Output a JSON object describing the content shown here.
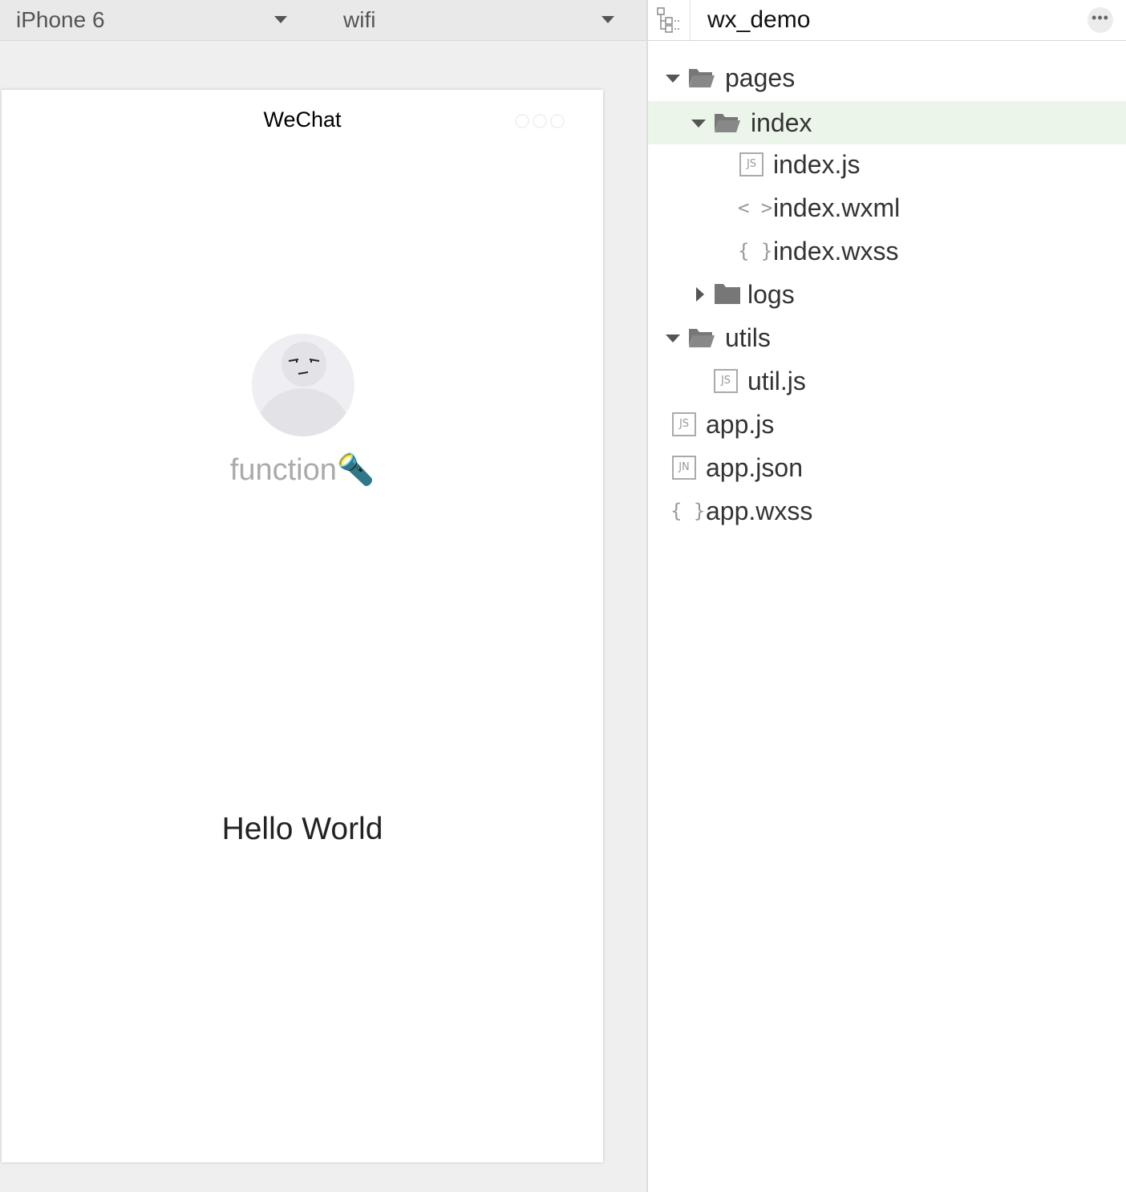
{
  "simulator": {
    "device": "iPhone 6",
    "network": "wifi",
    "nav_title": "WeChat",
    "nickname": "function🔦",
    "body_text": "Hello World"
  },
  "explorer": {
    "project_name": "wx_demo",
    "tree": [
      {
        "label": "pages",
        "type": "folder",
        "state": "open"
      },
      {
        "label": "index",
        "type": "folder",
        "state": "open",
        "selected": true
      },
      {
        "label": "index.js",
        "type": "file",
        "icon": "js-file-icon",
        "badge": "JS"
      },
      {
        "label": "index.wxml",
        "type": "file",
        "icon": "wxml-file-icon",
        "badge": "< >"
      },
      {
        "label": "index.wxss",
        "type": "file",
        "icon": "wxss-file-icon",
        "badge": "{ }"
      },
      {
        "label": "logs",
        "type": "folder",
        "state": "closed"
      },
      {
        "label": "utils",
        "type": "folder",
        "state": "open"
      },
      {
        "label": "util.js",
        "type": "file",
        "icon": "js-file-icon",
        "badge": "JS"
      },
      {
        "label": "app.js",
        "type": "file",
        "icon": "js-file-icon",
        "badge": "JS"
      },
      {
        "label": "app.json",
        "type": "file",
        "icon": "json-file-icon",
        "badge": "JN"
      },
      {
        "label": "app.wxss",
        "type": "file",
        "icon": "wxss-file-icon",
        "badge": "{ }"
      }
    ]
  },
  "colors": {
    "selected_row": "#ebf5ea",
    "panel_bg": "#efefef"
  }
}
